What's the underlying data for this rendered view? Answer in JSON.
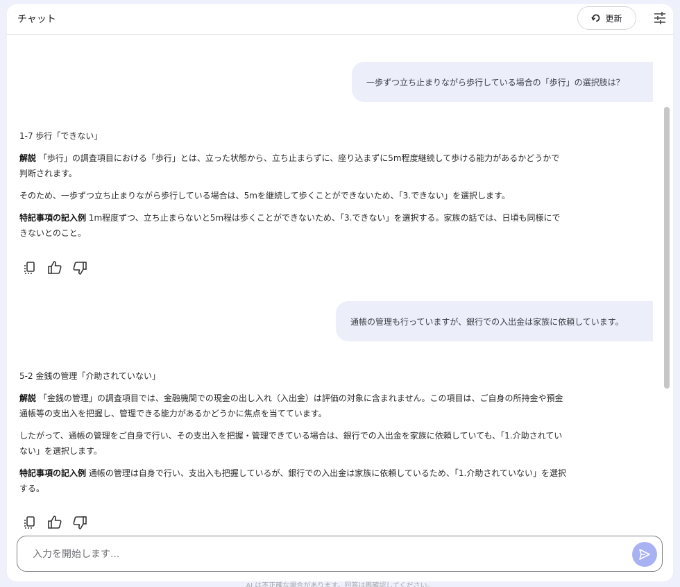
{
  "header": {
    "title": "チャット",
    "refresh_label": "更新"
  },
  "messages": [
    {
      "role": "user",
      "text": "一歩ずつ立ち止まりながら歩行している場合の「歩行」の選択肢は？"
    },
    {
      "role": "assistant",
      "heading": "1-7 歩行「できない」",
      "explanation_label": "解説",
      "explanation": "「歩行」の調査項目における「歩行」とは、立った状態から、立ち止まらずに、座り込まずに5m程度継続して歩ける能力があるかどうかで判断されます。",
      "paragraph": "そのため、一歩ずつ立ち止まりながら歩行している場合は、5mを継続して歩くことができないため、「3.できない」を選択します。",
      "note_label": "特記事項の記入例",
      "note": "1m程度ずつ、立ち止まらないと5m程は歩くことができないため、「3.できない」を選択する。家族の話では、日頃も同様にできないとのこと。"
    },
    {
      "role": "user",
      "text": "通帳の管理も行っていますが、銀行での入出金は家族に依頼しています。"
    },
    {
      "role": "assistant",
      "heading": "5-2 金銭の管理「介助されていない」",
      "explanation_label": "解説",
      "explanation": "「金銭の管理」の調査項目では、金融機関での現金の出し入れ（入出金）は評価の対象に含まれません。この項目は、ご自身の所持金や預金通帳等の支出入を把握し、管理できる能力があるかどうかに焦点を当てています。",
      "paragraph": "したがって、通帳の管理をご自身で行い、その支出入を把握・管理できている場合は、銀行での入出金を家族に依頼していても、「1.介助されていない」を選択します。",
      "note_label": "特記事項の記入例",
      "note": "通帳の管理は自身で行い、支出入も把握しているが、銀行での入出金は家族に依頼しているため、「1.介助されていない」を選択する。"
    }
  ],
  "input": {
    "placeholder": "入力を開始します..."
  },
  "footer": {
    "note": "AI は不正確な場合があります。回答は再確認してください。"
  },
  "icons": {
    "refresh": "refresh-icon",
    "tune": "tune-icon",
    "copy": "copy-icon",
    "thumbs_up": "thumbs-up-icon",
    "thumbs_down": "thumbs-down-icon",
    "send": "send-icon"
  },
  "colors": {
    "page_bg": "#eef0fb",
    "user_bubble": "#eceefa",
    "send_button": "#a8b2f3"
  }
}
